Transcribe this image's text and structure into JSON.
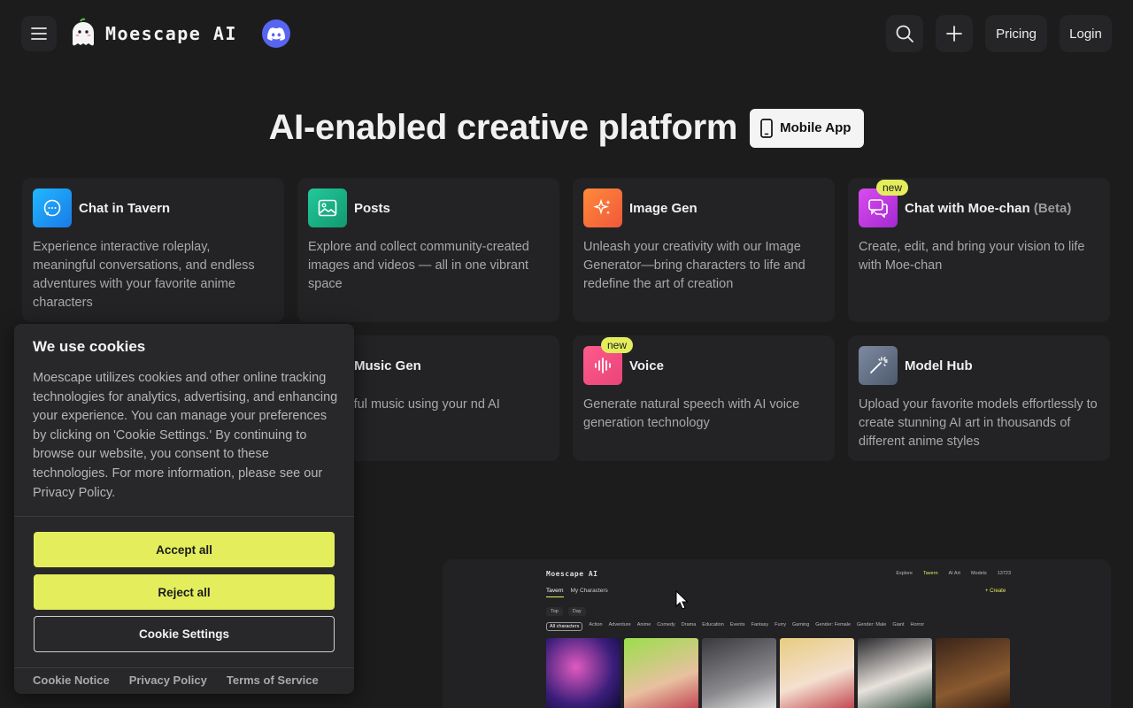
{
  "header": {
    "brand": "Moescape AI",
    "pricing_label": "Pricing",
    "login_label": "Login"
  },
  "hero": {
    "title": "AI-enabled creative platform",
    "mobile_app_label": "Mobile App"
  },
  "cards": [
    {
      "title": "Chat in Tavern",
      "desc": "Experience interactive roleplay, meaningful conversations, and endless adventures with your favorite anime characters",
      "icon": "chat-bubble-icon",
      "color": "#1ea7f5"
    },
    {
      "title": "Posts",
      "desc": "Explore and collect community-created images and videos — all in one vibrant space",
      "icon": "image-icon",
      "color": "#17b987"
    },
    {
      "title": "Image Gen",
      "desc": "Unleash your creativity with our Image Generator—bring characters to life and redefine the art of creation",
      "icon": "sparkle-icon",
      "color": "#f77a3a"
    },
    {
      "title": "Chat with Moe-chan",
      "beta": "(Beta)",
      "badge": "new",
      "desc": "Create, edit, and bring your vision to life with Moe-chan",
      "icon": "chat-bubbles-icon",
      "color": "#c23ee0"
    },
    {
      "title": "Music Gen",
      "desc": "e beautiful music using your nd AI",
      "icon": "music-icon",
      "color": "#7a56e8"
    },
    {
      "title": "Voice",
      "badge": "new",
      "desc": "Generate natural speech with AI voice generation technology",
      "icon": "waveform-icon",
      "color": "#f0447c"
    },
    {
      "title": "Model Hub",
      "desc": "Upload your favorite models effortlessly to create stunning AI art in thousands of different anime styles",
      "icon": "magic-wand-icon",
      "color": "#5c6b7e"
    }
  ],
  "preview": {
    "brand": "Moescape AI",
    "nav": [
      "Explore",
      "Tavern",
      "AI Art",
      "Models",
      "13723"
    ],
    "tabs": [
      "Tavern",
      "My Characters"
    ],
    "create": "+ Create",
    "filters": [
      "Top",
      "Day"
    ],
    "categories": [
      "All characters",
      "Action",
      "Adventure",
      "Anime",
      "Comedy",
      "Drama",
      "Education",
      "Events",
      "Fantasy",
      "Furry",
      "Gaming",
      "Gender: Female",
      "Gender: Male",
      "Giant",
      "Horror"
    ]
  },
  "cookie": {
    "title": "We use cookies",
    "body": "Moescape utilizes cookies and other online tracking technologies for analytics, advertising, and enhancing your experience. You can manage your preferences by clicking on 'Cookie Settings.' By continuing to browse our website, you consent to these technologies. For more information, please see our Privacy Policy.",
    "accept_label": "Accept all",
    "reject_label": "Reject all",
    "settings_label": "Cookie Settings",
    "links": [
      "Cookie Notice",
      "Privacy Policy",
      "Terms of Service"
    ]
  }
}
